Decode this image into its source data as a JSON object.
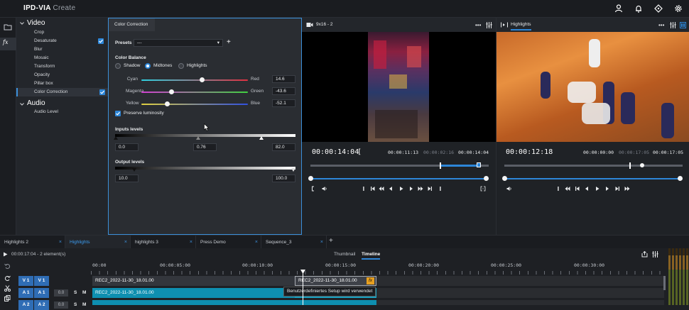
{
  "app": {
    "title": "IPD-VIA",
    "subtitle": "Create"
  },
  "tree": {
    "video_label": "Video",
    "video_items": [
      "Crop",
      "Desaturate",
      "Blur",
      "Mosaic",
      "Transform",
      "Opacity",
      "Pillar box",
      "Color Correction"
    ],
    "audio_label": "Audio",
    "audio_items": [
      "Audio Level"
    ]
  },
  "cc": {
    "tab": "Color Correction",
    "presets_label": "Presets",
    "presets_value": "---",
    "color_balance": "Color Balance",
    "modes": [
      "Shadow",
      "Midtones",
      "Highlights"
    ],
    "selected_mode": "Midtones",
    "sliders": [
      {
        "left": "Cyan",
        "right": "Red",
        "value": "14.6",
        "pos": 0.57
      },
      {
        "left": "Magenta",
        "right": "Green",
        "value": "-43.6",
        "pos": 0.28
      },
      {
        "left": "Yellow",
        "right": "Blue",
        "value": "-52.1",
        "pos": 0.24
      }
    ],
    "preserve": "Preserve luminosity",
    "inputs_label": "Inputs levels",
    "inputs_values": [
      "0.0",
      "0.76",
      "82.0"
    ],
    "output_label": "Output levels",
    "output_values": [
      "10.0",
      "100.0"
    ]
  },
  "viewer1": {
    "title": "9x16 - 2",
    "timecode": "00:00:14:04",
    "bracket": "[",
    "in": "00:00:11:13",
    "dur": "00:00:02:16",
    "out": "00:00:14:04"
  },
  "viewer2": {
    "title": "Highlights",
    "timecode": "00:00:12:18",
    "in": "00:00:00:00",
    "dur": "00:00:17:05",
    "out": "00:00:17:05"
  },
  "tabs": [
    "Highlights 2",
    "Highlights",
    "highlights 3",
    "Press Demo",
    "Sequence_3"
  ],
  "active_tab": "Highlights",
  "timeline": {
    "info": "00:00:17:04 - 2 element(s)",
    "view_tabs": [
      "Thumbnail",
      "Timeline"
    ],
    "active_view": "Timeline",
    "ruler": [
      "00:00",
      "00:00:05:00",
      "00:00:10:00",
      "00:00:15:00",
      "00:00:20:00",
      "00:00:25:00",
      "00:00:30:00"
    ],
    "tracks": [
      {
        "a": "V 1",
        "b": "V 1"
      },
      {
        "a": "A 1",
        "b": "A 1",
        "level": "0.0",
        "s": "S",
        "m": "M"
      },
      {
        "a": "A 2",
        "b": "A 2",
        "level": "0.0",
        "s": "S",
        "m": "M"
      }
    ],
    "clip_name": "REC2_2022-11-30_18.01.00",
    "fx": "fx",
    "tooltip": "Benutzerdefiniertes Setup wird verwendet"
  },
  "colors": {
    "accent": "#2d86d8",
    "clip_blue": "#0e8fb0",
    "clip_dark": "#33363c",
    "fx": "#e8a020"
  }
}
